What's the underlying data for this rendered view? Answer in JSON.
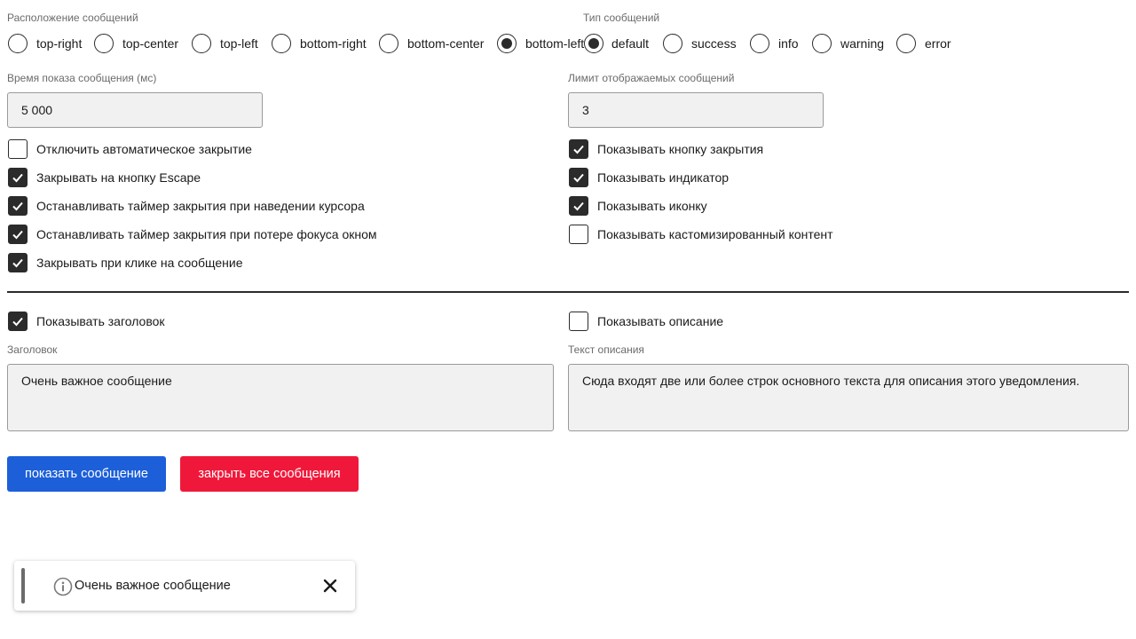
{
  "position": {
    "label": "Расположение сообщений",
    "options": [
      "top-right",
      "top-center",
      "top-left",
      "bottom-right",
      "bottom-center",
      "bottom-left"
    ],
    "selected": "bottom-left"
  },
  "type": {
    "label": "Тип сообщений",
    "options": [
      "default",
      "success",
      "info",
      "warning",
      "error"
    ],
    "selected": "default"
  },
  "duration": {
    "label": "Время показа сообщения (мс)",
    "value": "5 000"
  },
  "limit": {
    "label": "Лимит отображаемых сообщений",
    "value": "3"
  },
  "options_left": [
    {
      "label": "Отключить автоматическое закрытие",
      "checked": false
    },
    {
      "label": "Закрывать на кнопку Escape",
      "checked": true
    },
    {
      "label": "Останавливать таймер закрытия при наведении курсора",
      "checked": true
    },
    {
      "label": "Останавливать таймер закрытия при потере фокуса окном",
      "checked": true
    },
    {
      "label": "Закрывать при клике на сообщение",
      "checked": true
    }
  ],
  "options_right": [
    {
      "label": "Показывать кнопку закрытия",
      "checked": true
    },
    {
      "label": "Показывать индикатор",
      "checked": true
    },
    {
      "label": "Показывать иконку",
      "checked": true
    },
    {
      "label": "Показывать кастомизированный контент",
      "checked": false
    }
  ],
  "show_title": {
    "label": "Показывать заголовок",
    "checked": true
  },
  "show_description": {
    "label": "Показывать описание",
    "checked": false
  },
  "title_field": {
    "label": "Заголовок",
    "value": "Очень важное сообщение"
  },
  "description_field": {
    "label": "Текст описания",
    "value": "Сюда входят две или более строк основного текста для описания этого уведомления."
  },
  "buttons": {
    "show": "показать сообщение",
    "close_all": "закрыть все сообщения"
  },
  "toast": {
    "title": "Очень важное сообщение",
    "icon": "info-icon",
    "close_icon": "close-icon"
  },
  "colors": {
    "primary": "#1c5fd9",
    "danger": "#f0183a",
    "checkbox": "#2b2b2b",
    "field_bg": "#f1f1f1"
  }
}
